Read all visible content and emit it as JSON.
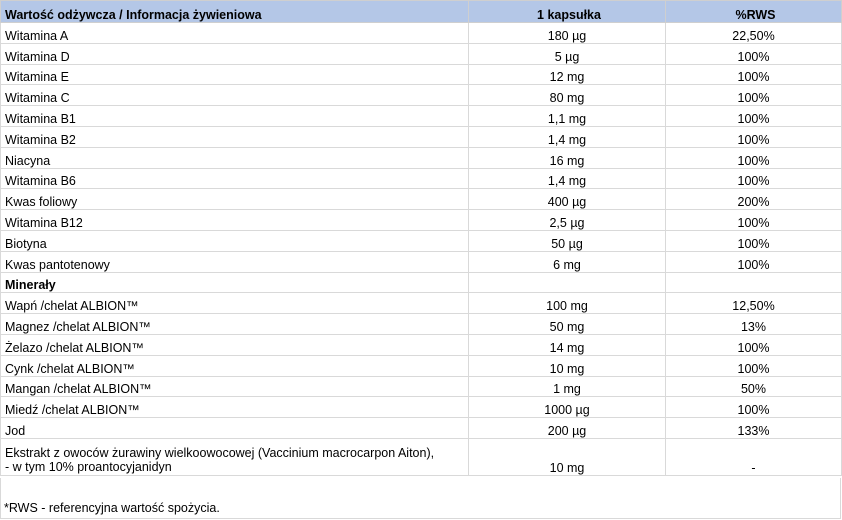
{
  "header": {
    "name": "Wartość odżywcza / Informacja żywieniowa",
    "amount": "1 kapsułka",
    "rws": "%RWS"
  },
  "vitamins": [
    {
      "name": "Witamina A",
      "amount": "180 µg",
      "rws": "22,50%"
    },
    {
      "name": "Witamina D",
      "amount": "5 µg",
      "rws": "100%"
    },
    {
      "name": "Witamina E",
      "amount": "12 mg",
      "rws": "100%"
    },
    {
      "name": "Witamina C",
      "amount": "80 mg",
      "rws": "100%"
    },
    {
      "name": "Witamina B1",
      "amount": "1,1 mg",
      "rws": "100%"
    },
    {
      "name": "Witamina B2",
      "amount": "1,4 mg",
      "rws": "100%"
    },
    {
      "name": "Niacyna",
      "amount": "16 mg",
      "rws": "100%"
    },
    {
      "name": "Witamina B6",
      "amount": "1,4 mg",
      "rws": "100%"
    },
    {
      "name": "Kwas foliowy",
      "amount": "400 µg",
      "rws": "200%"
    },
    {
      "name": "Witamina B12",
      "amount": "2,5 µg",
      "rws": "100%"
    },
    {
      "name": "Biotyna",
      "amount": "50 µg",
      "rws": "100%"
    },
    {
      "name": "Kwas pantotenowy",
      "amount": "6 mg",
      "rws": "100%"
    }
  ],
  "minerals_section": "Minerały",
  "minerals": [
    {
      "name": "Wapń /chelat ALBION™",
      "amount": "100 mg",
      "rws": "12,50%"
    },
    {
      "name": "Magnez /chelat ALBION™",
      "amount": "50 mg",
      "rws": "13%"
    },
    {
      "name": "Żelazo /chelat ALBION™",
      "amount": "14 mg",
      "rws": "100%"
    },
    {
      "name": "Cynk /chelat ALBION™",
      "amount": "10 mg",
      "rws": "100%"
    },
    {
      "name": "Mangan /chelat ALBION™",
      "amount": "1 mg",
      "rws": "50%"
    },
    {
      "name": "Miedź /chelat ALBION™",
      "amount": "1000 µg",
      "rws": "100%"
    },
    {
      "name": "Jod",
      "amount": "200 µg",
      "rws": "133%"
    }
  ],
  "extract": {
    "name_line1": "Ekstrakt z owoców żurawiny wielkoowocowej (Vaccinium macrocarpon Aiton),",
    "name_line2": "- w tym 10% proantocyjanidyn",
    "amount": "10 mg",
    "rws": "-"
  },
  "footnote": "*RWS - referencyjna wartość spożycia."
}
